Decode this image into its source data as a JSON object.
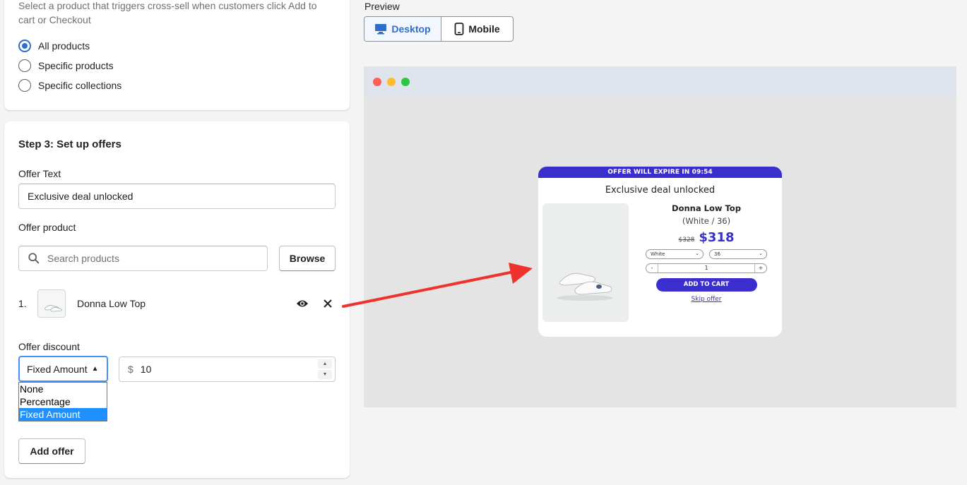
{
  "trigger": {
    "help_text": "Select a product that triggers cross-sell when customers click Add to cart or Checkout",
    "options": [
      {
        "label": "All products",
        "checked": true
      },
      {
        "label": "Specific products",
        "checked": false
      },
      {
        "label": "Specific collections",
        "checked": false
      }
    ]
  },
  "step3": {
    "title": "Step 3: Set up offers",
    "offer_text_label": "Offer Text",
    "offer_text_value": "Exclusive deal unlocked",
    "offer_product_label": "Offer product",
    "search_placeholder": "Search products",
    "browse_label": "Browse",
    "offers": [
      {
        "number": "1.",
        "name": "Donna Low Top"
      }
    ],
    "discount_label": "Offer discount",
    "discount_type": "Fixed Amount",
    "discount_options": [
      "None",
      "Percentage",
      "Fixed Amount"
    ],
    "discount_currency": "$",
    "discount_value": "10",
    "add_offer_label": "Add offer"
  },
  "preview": {
    "label": "Preview",
    "desktop_label": "Desktop",
    "mobile_label": "Mobile",
    "active_mode": "desktop"
  },
  "popup": {
    "banner": "OFFER WILL EXPIRE IN 09:54",
    "title": "Exclusive deal unlocked",
    "product_name": "Donna Low Top",
    "variant": "(White / 36)",
    "old_price": "$328",
    "new_price": "$318",
    "color_option": "White",
    "size_option": "36",
    "qty_minus": "-",
    "qty_value": "1",
    "qty_plus": "+",
    "add_to_cart": "ADD TO CART",
    "skip": "Skip offer",
    "accent_color": "#3a2fce"
  },
  "colors": {
    "primary_blue": "#2c6ecb",
    "arrow_red": "#f0322e"
  }
}
